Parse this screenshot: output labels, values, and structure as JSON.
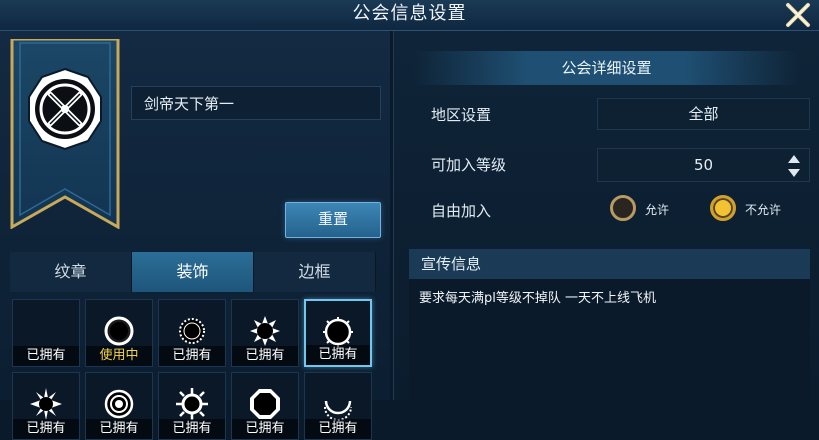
{
  "window": {
    "title": "公会信息设置"
  },
  "guild": {
    "name": "剑帝天下第一"
  },
  "buttons": {
    "reset_label": "重置"
  },
  "tabs": [
    {
      "label": "纹章",
      "active": false
    },
    {
      "label": "装饰",
      "active": true
    },
    {
      "label": "边框",
      "active": false
    }
  ],
  "decorations": [
    {
      "status": "已拥有",
      "icon": "empty-frame-icon"
    },
    {
      "status": "使用中",
      "icon": "ring-frame-icon"
    },
    {
      "status": "已拥有",
      "icon": "dotted-ring-frame-icon"
    },
    {
      "status": "已拥有",
      "icon": "sun-spike-frame-icon"
    },
    {
      "status": "已拥有",
      "icon": "thorn-ring-frame-icon",
      "selected": true
    },
    {
      "status": "已拥有",
      "icon": "star-burst-frame-icon"
    },
    {
      "status": "已拥有",
      "icon": "double-ring-frame-icon"
    },
    {
      "status": "已拥有",
      "icon": "sun-ray-frame-icon"
    },
    {
      "status": "已拥有",
      "icon": "octagon-frame-icon"
    },
    {
      "status": "已拥有",
      "icon": "crescent-frame-icon"
    }
  ],
  "settings": {
    "header": "公会详细设置",
    "region_label": "地区设置",
    "region_value": "全部",
    "level_label": "可加入等级",
    "level_value": "50",
    "free_join_label": "自由加入",
    "option_allow": "允许",
    "option_deny": "不允许",
    "selected_option": "不允许"
  },
  "promo": {
    "header": "宣传信息",
    "text": "要求每天满pl等级不掉队 一天不上线飞机"
  },
  "colors": {
    "accent": "#2b6e98",
    "in_use": "#f6d44a",
    "radio_on": "#f1c232"
  }
}
